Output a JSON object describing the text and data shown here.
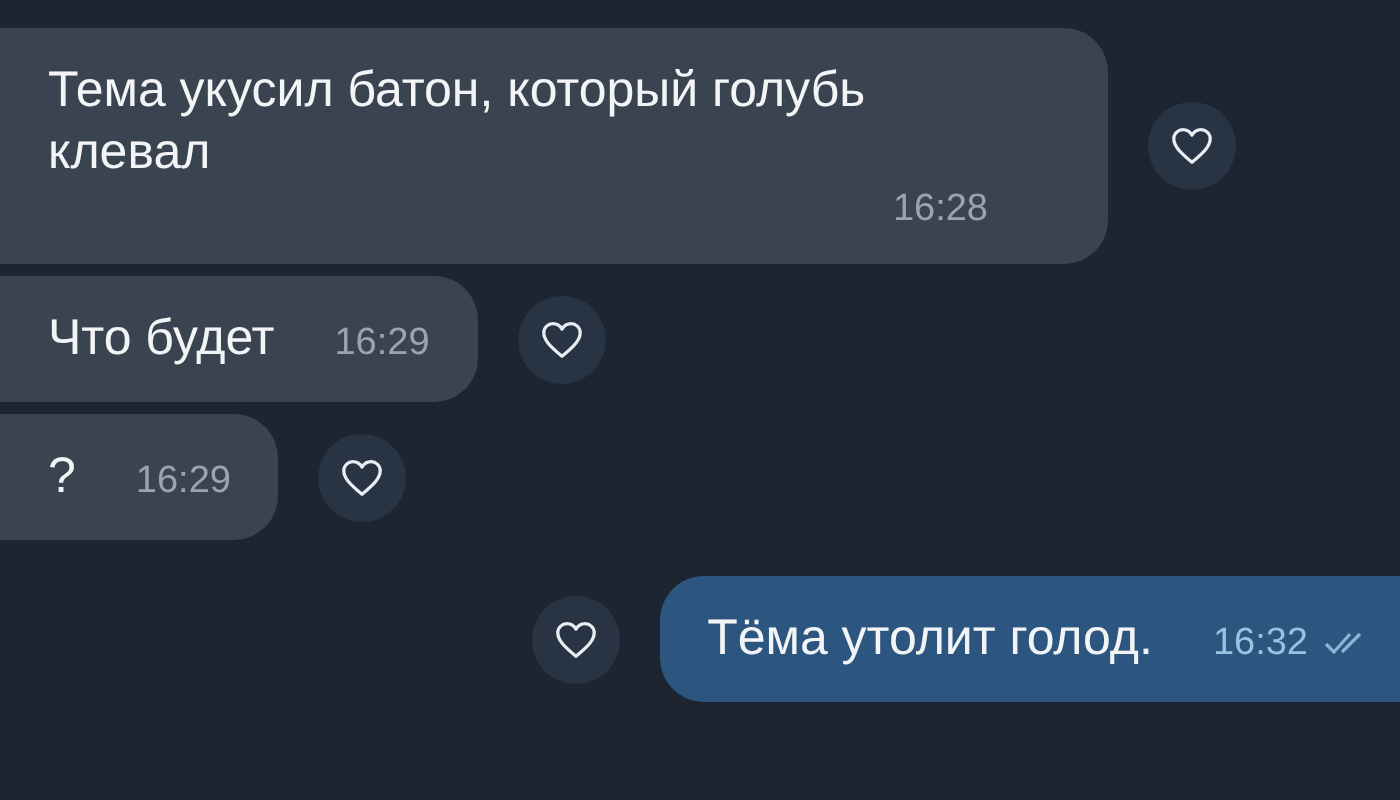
{
  "messages": [
    {
      "kind": "incoming",
      "text": "Тема укусил батон, который голубь клевал",
      "time": "16:28"
    },
    {
      "kind": "incoming",
      "text": "Что будет",
      "time": "16:29"
    },
    {
      "kind": "incoming",
      "text": "?",
      "time": "16:29"
    },
    {
      "kind": "outgoing",
      "text": "Тёма утолит голод.",
      "time": "16:32",
      "read": true
    }
  ]
}
